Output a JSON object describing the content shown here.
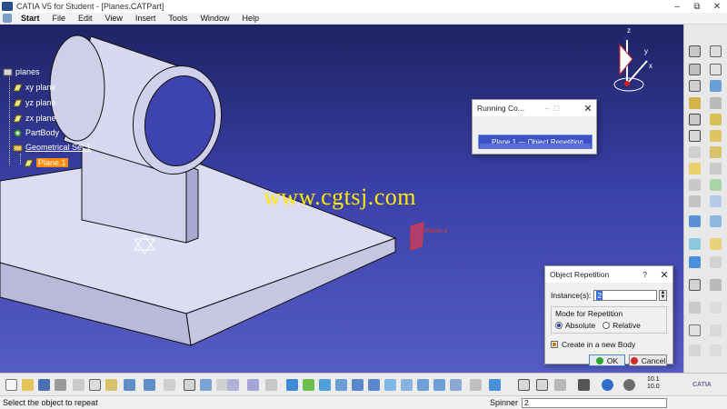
{
  "window": {
    "title": "CATIA V5 for Student - [Planes.CATPart]",
    "minimize": "–",
    "restore": "⧉",
    "close": "✕"
  },
  "menu": [
    "Start",
    "File",
    "Edit",
    "View",
    "Insert",
    "Tools",
    "Window",
    "Help"
  ],
  "tree": {
    "root": "planes",
    "items": [
      {
        "label": "xy plane"
      },
      {
        "label": "yz plane"
      },
      {
        "label": "zx plane"
      },
      {
        "label": "PartBody"
      },
      {
        "label": "Geometrical Set.1"
      },
      {
        "label": "Plane.1"
      }
    ]
  },
  "watermark": "www.cgtsj.com",
  "viewport_label": "Plane.1",
  "compass_axes": {
    "x": "x",
    "y": "y",
    "z": "z"
  },
  "running_commands": {
    "title": "Running Co...",
    "strip": "Plane.1 — Object Repetition"
  },
  "object_repetition": {
    "title": "Object Repetition",
    "help": "?",
    "instances_label": "Instance(s):",
    "instances_value": "2",
    "mode_label": "Mode for Repetition",
    "absolute_label": "Absolute",
    "relative_label": "Relative",
    "absolute_selected": true,
    "create_body_label": "Create in a new Body",
    "create_body_checked": true,
    "ok_label": "OK",
    "cancel_label": "Cancel"
  },
  "status": {
    "message": "Select the object to repeat",
    "spinner_label": "Spinner",
    "spinner_value": "2"
  },
  "ratio_label": {
    "top": "10.1",
    "bottom": "10.0"
  },
  "logo_text": "CATIA",
  "colors": {
    "viewport_top": "#1e2363",
    "viewport_bottom": "#555cc4",
    "selection": "#ff8a00",
    "watermark": "#ffea00"
  }
}
